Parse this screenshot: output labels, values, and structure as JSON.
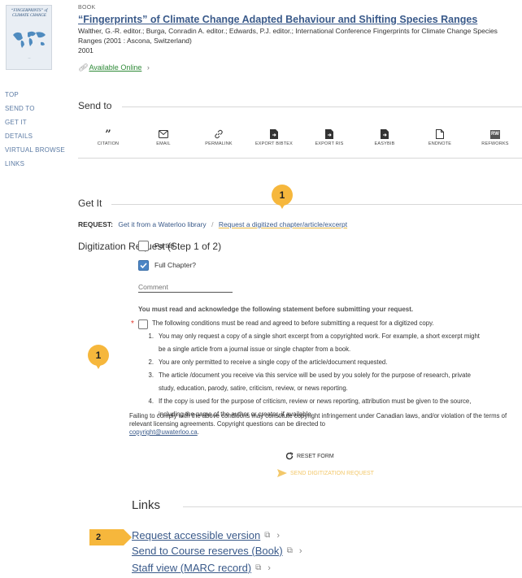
{
  "record": {
    "type": "BOOK",
    "title": "“Fingerprints” of Climate Change Adapted Behaviour and Shifting Species Ranges",
    "authors": "Walther, G.-R. editor.; Burga, Conradin A. editor.; Edwards, P.J. editor.; International Conference Fingerprints for Climate Change Species Ranges (2001 : Ascona, Switzerland)",
    "year": "2001",
    "availability": "Available Online",
    "thumbnail": {
      "cover_title": "“FINGERPRINTS” of CLIMATE CHANGE"
    }
  },
  "sidenav": [
    "TOP",
    "SEND TO",
    "GET IT",
    "DETAILS",
    "VIRTUAL BROWSE",
    "LINKS"
  ],
  "send_to": {
    "title": "Send to",
    "items": [
      {
        "label": "CITATION",
        "icon": "quote-icon"
      },
      {
        "label": "EMAIL",
        "icon": "envelope-icon"
      },
      {
        "label": "PERMALINK",
        "icon": "link-icon"
      },
      {
        "label": "EXPORT BIBTEX",
        "icon": "file-export-icon"
      },
      {
        "label": "EXPORT RIS",
        "icon": "file-export-icon"
      },
      {
        "label": "EASYBIB",
        "icon": "file-export-icon"
      },
      {
        "label": "ENDNOTE",
        "icon": "document-icon"
      },
      {
        "label": "REFWORKS",
        "icon": "refworks-icon",
        "badge": "RW"
      }
    ]
  },
  "get_it": {
    "title": "Get It",
    "request_label": "REQUEST:",
    "option_1": "Get it from a Waterloo library",
    "option_2": "Request a digitized chapter/article/excerpt"
  },
  "digitization": {
    "title": "Digitization Request (Step 1 of 2)",
    "partial_label": "Partial",
    "partial_checked": false,
    "full_chapter_label": "Full Chapter?",
    "full_chapter_checked": true,
    "comment_placeholder": "Comment",
    "must_read": "You must read and acknowledge the following statement before submitting your request.",
    "terms_intro": "The following conditions must be read and agreed to before submitting a request for a digitized copy.",
    "terms": [
      {
        "num": "1.",
        "lines": [
          "You may only request a copy of a single short excerpt from a copyrighted work. For example, a short excerpt might",
          "be a single article from a journal issue or single chapter from a book."
        ]
      },
      {
        "num": "2.",
        "lines": [
          "You are only permitted to receive a single copy of the article/document requested."
        ]
      },
      {
        "num": "3.",
        "lines": [
          "The article /document you receive via this service will be used by you solely for the purpose of research, private",
          "study, education, parody, satire, criticism, review, or news reporting."
        ]
      },
      {
        "num": "4.",
        "lines": [
          "If the copy is used for the purpose of criticism, review or news reporting, attribution must be given to the source,",
          "including the name of the author or creator, if available."
        ]
      }
    ],
    "failure_text": "Failing to comply with the above conditions may constitute copyright infringement under Canadian laws, and/or violation of the terms of relevant licensing agreements. Copyright questions can be directed to",
    "email": "copyright@uwaterloo.ca",
    "email_suffix": ".",
    "reset_label": "RESET FORM",
    "send_label": "SEND DIGITIZATION REQUEST"
  },
  "links": {
    "title": "Links",
    "items": [
      "Request accessible version",
      "Send to Course reserves (Book)",
      "Staff view (MARC record)"
    ]
  },
  "annotations": {
    "marker_top": "1",
    "marker_left": "1",
    "marker_links": "2",
    "color": "#f6b73c"
  }
}
